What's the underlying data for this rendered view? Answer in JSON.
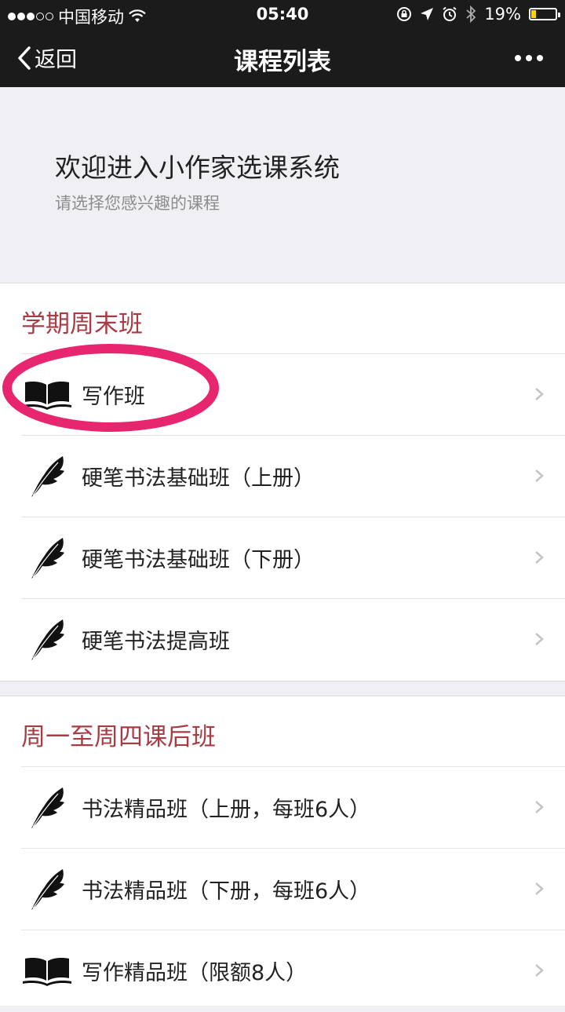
{
  "status": {
    "carrier": "中国移动",
    "time": "05:40",
    "battery": "19%",
    "battery_level": 0.19
  },
  "nav": {
    "back_label": "返回",
    "title": "课程列表"
  },
  "intro": {
    "title": "欢迎进入小作家选课系统",
    "subtitle": "请选择您感兴趣的课程"
  },
  "sections": [
    {
      "title": "学期周末班",
      "items": [
        {
          "label": "写作班",
          "icon": "book-icon"
        },
        {
          "label": "硬笔书法基础班（上册）",
          "icon": "feather-icon"
        },
        {
          "label": "硬笔书法基础班（下册）",
          "icon": "feather-icon"
        },
        {
          "label": "硬笔书法提高班",
          "icon": "feather-icon"
        }
      ]
    },
    {
      "title": "周一至周四课后班",
      "items": [
        {
          "label": "书法精品班（上册，每班6人）",
          "icon": "feather-icon"
        },
        {
          "label": "书法精品班（下册，每班6人）",
          "icon": "feather-icon"
        },
        {
          "label": "写作精品班（限额8人）",
          "icon": "book-icon"
        }
      ]
    }
  ],
  "colors": {
    "accent": "#a83c45",
    "highlight": "#e8256f",
    "navbar": "#1b1b1b"
  }
}
